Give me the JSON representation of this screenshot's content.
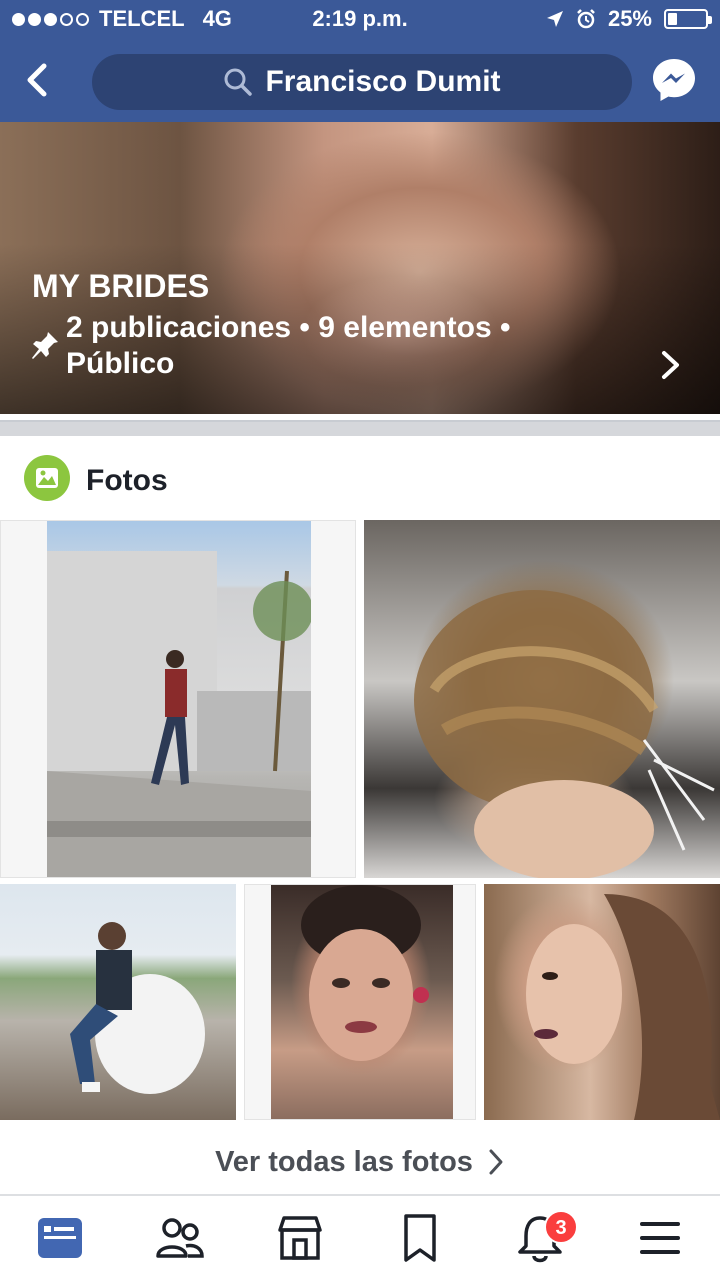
{
  "status_bar": {
    "carrier": "TELCEL",
    "network": "4G",
    "time": "2:19 p.m.",
    "battery": "25%",
    "battery_level": 0.25,
    "signal_bars": 3
  },
  "nav": {
    "search_text": "Francisco Dumit",
    "back_icon": "chevron-left-icon",
    "messenger_icon": "messenger-icon"
  },
  "album": {
    "title": "MY BRIDES",
    "meta_line1": "2 publicaciones • 9 elementos •",
    "meta_line2": "Público"
  },
  "photos_section": {
    "title": "Fotos",
    "see_all": "Ver todas las fotos"
  },
  "tabbar": {
    "items": [
      "news-feed-icon",
      "friends-icon",
      "marketplace-icon",
      "saved-icon",
      "notifications-icon",
      "menu-icon"
    ],
    "notifications_badge": "3",
    "active_color": "#4267b2",
    "inactive_color": "#1d2129"
  },
  "colors": {
    "header_bg": "#3b5998",
    "search_bg": "#2d4373",
    "photo_icon_green": "#8cc63f",
    "badge_red": "#fa3e3e"
  }
}
